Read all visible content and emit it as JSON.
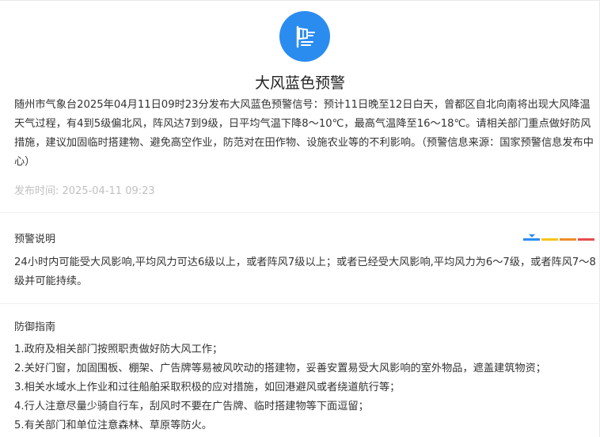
{
  "alert": {
    "icon": "wind-flag-icon",
    "icon_color": "#2b8cf0",
    "title": "大风蓝色预警",
    "body": "随州市气象台2025年04月11日09时23分发布大风蓝色预警信号：预计11日晚至12日白天，曾都区自北向南将出现大风降温天气过程，有4到5级偏北风，阵风达7到9级，日平均气温下降8～10℃，最高气温降至16～18℃。请相关部门重点做好防风措施，建议加固临时搭建物、避免高空作业，防范对在田作物、设施农业等的不利影响。（预警信息来源：国家预警信息发布中心）",
    "publish_label": "发布时间: ",
    "publish_time": "2025-04-11 09:23"
  },
  "explanation": {
    "title": "预警说明",
    "levels": [
      "#2b8cf0",
      "#f5c518",
      "#f08c28",
      "#e84c4c"
    ],
    "current_level": "蓝色",
    "text": "24小时内可能受大风影响,平均风力可达6级以上，或者阵风7级以上；或者已经受大风影响,平均风力为6～7级，或者阵风7～8级并可能持续。"
  },
  "guide": {
    "title": "防御指南",
    "items": [
      "1.政府及相关部门按照职责做好防大风工作；",
      "2.关好门窗，加固围板、棚架、广告牌等易被风吹动的搭建物，妥善安置易受大风影响的室外物品，遮盖建筑物资；",
      "3.相关水域水上作业和过往船舶采取积极的应对措施，如回港避风或者绕道航行等；",
      "4.行人注意尽量少骑自行车，刮风时不要在广告牌、临时搭建物等下面逗留；",
      "5.有关部门和单位注意森林、草原等防火。"
    ]
  }
}
